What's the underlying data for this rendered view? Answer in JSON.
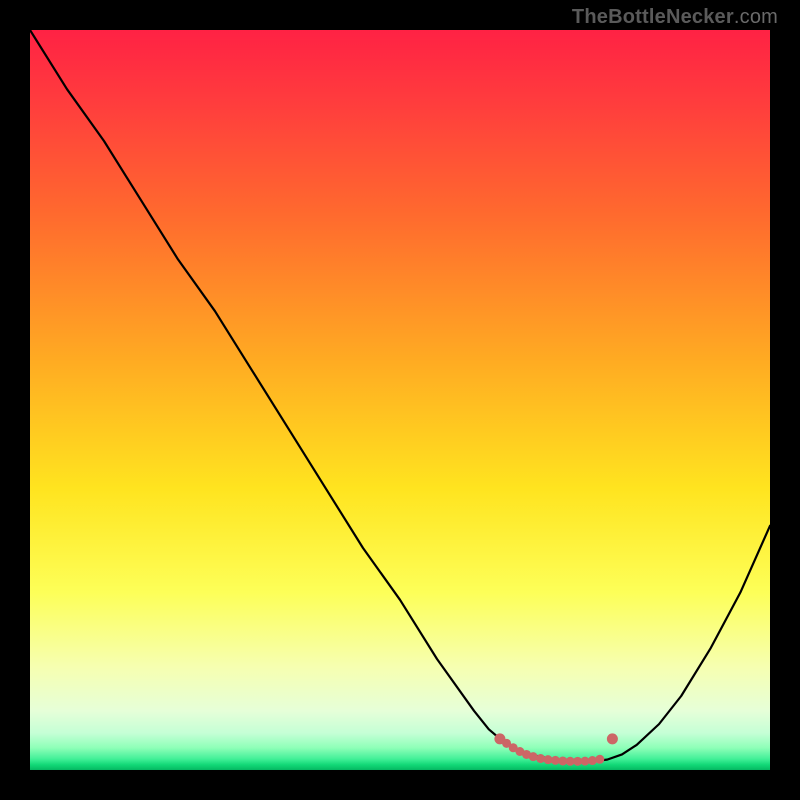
{
  "watermark": {
    "brand": "TheBottleNecker",
    "tld": ".com"
  },
  "chart_data": {
    "type": "line",
    "title": "",
    "xlabel": "",
    "ylabel": "",
    "xlim": [
      0,
      100
    ],
    "ylim": [
      0,
      100
    ],
    "grid": false,
    "series": [
      {
        "name": "bottleneck-curve",
        "x": [
          0,
          5,
          10,
          15,
          20,
          25,
          30,
          35,
          40,
          45,
          50,
          55,
          60,
          62,
          64,
          65,
          66,
          67,
          68,
          70,
          72,
          73,
          74,
          75,
          76,
          78,
          80,
          82,
          85,
          88,
          92,
          96,
          100
        ],
        "y": [
          100,
          92,
          85,
          77,
          69,
          62,
          54,
          46,
          38,
          30,
          23,
          15,
          8,
          5.5,
          3.8,
          3.2,
          2.7,
          2.3,
          2.0,
          1.6,
          1.3,
          1.2,
          1.15,
          1.15,
          1.2,
          1.4,
          2.1,
          3.4,
          6.2,
          10.0,
          16.5,
          24.0,
          33.0
        ]
      }
    ],
    "markers": {
      "name": "optimal-range",
      "color": "#cc6666",
      "points": [
        {
          "x": 63.5,
          "y": 4.2
        },
        {
          "x": 64.4,
          "y": 3.6
        },
        {
          "x": 65.3,
          "y": 3.0
        },
        {
          "x": 66.2,
          "y": 2.5
        },
        {
          "x": 67.1,
          "y": 2.1
        },
        {
          "x": 68.0,
          "y": 1.8
        },
        {
          "x": 69.0,
          "y": 1.55
        },
        {
          "x": 70.0,
          "y": 1.4
        },
        {
          "x": 71.0,
          "y": 1.3
        },
        {
          "x": 72.0,
          "y": 1.22
        },
        {
          "x": 73.0,
          "y": 1.18
        },
        {
          "x": 74.0,
          "y": 1.17
        },
        {
          "x": 75.0,
          "y": 1.2
        },
        {
          "x": 76.0,
          "y": 1.28
        },
        {
          "x": 77.0,
          "y": 1.45
        },
        {
          "x": 78.7,
          "y": 4.2
        }
      ]
    },
    "background_gradient": {
      "top": "#ff2244",
      "mid": "#ffe41f",
      "bottom": "#05b862"
    }
  }
}
